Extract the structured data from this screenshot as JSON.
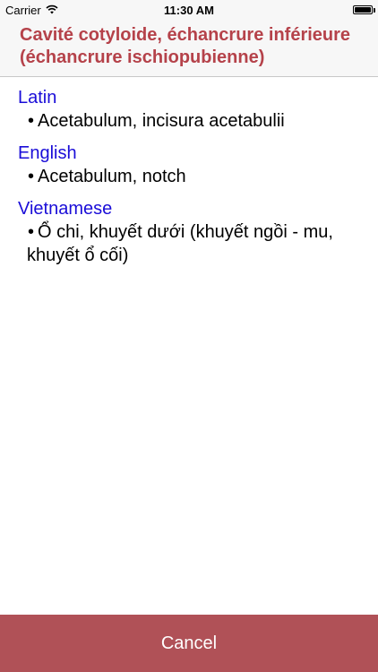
{
  "status_bar": {
    "carrier": "Carrier",
    "time": "11:30 AM",
    "icons": [
      "wifi-icon",
      "battery-icon"
    ]
  },
  "header": {
    "title": "Cavité cotyloide, échancrure inférieure (échancrure ischiopubienne)",
    "title_color": "#b5424a"
  },
  "entries": [
    {
      "language": "Latin",
      "term": "Acetabulum, incisura acetabulii"
    },
    {
      "language": "English",
      "term": "Acetabulum, notch"
    },
    {
      "language": "Vietnamese",
      "term": "Ổ chi, khuyết dưới (khuyết ngồi - mu,",
      "term_cont": "khuyết ổ cối)"
    }
  ],
  "bullet_symbol": "•",
  "language_color": "#1a0dd8",
  "cancel_button": {
    "label": "Cancel",
    "color": "#b05157"
  }
}
